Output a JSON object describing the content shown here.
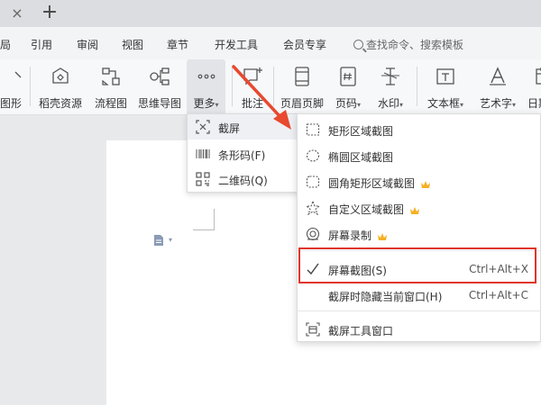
{
  "titlebar": {
    "close_glyph": "×",
    "add_glyph": "+"
  },
  "menu": {
    "items": [
      "局",
      "引用",
      "审阅",
      "视图",
      "章节",
      "开发工具",
      "会员专享"
    ],
    "search_placeholder": "查找命令、搜索模板"
  },
  "ribbon": {
    "items": [
      {
        "label": "图形",
        "icon": "shapes-icon"
      },
      {
        "label": "稻壳资源",
        "icon": "docer-icon"
      },
      {
        "label": "流程图",
        "icon": "flowchart-icon"
      },
      {
        "label": "思维导图",
        "icon": "mindmap-icon"
      },
      {
        "label": "更多",
        "icon": "more-icon"
      },
      {
        "label": "批注",
        "icon": "comment-icon"
      },
      {
        "label": "页眉页脚",
        "icon": "header-footer-icon"
      },
      {
        "label": "页码",
        "icon": "page-number-icon"
      },
      {
        "label": "水印",
        "icon": "watermark-icon"
      },
      {
        "label": "文本框",
        "icon": "textbox-icon"
      },
      {
        "label": "艺术字",
        "icon": "wordart-icon"
      },
      {
        "label": "日期",
        "icon": "date-icon"
      }
    ],
    "caret": "▾"
  },
  "dropdown1": {
    "items": [
      {
        "label": "截屏",
        "icon": "screenshot-icon"
      },
      {
        "label": "条形码(F)",
        "icon": "barcode-icon"
      },
      {
        "label": "二维码(Q)",
        "icon": "qrcode-icon"
      }
    ]
  },
  "dropdown2": {
    "items": [
      {
        "label": "矩形区域截图",
        "icon": "rect-region-icon",
        "shortcut": "",
        "premium": false
      },
      {
        "label": "椭圆区域截图",
        "icon": "ellipse-region-icon",
        "shortcut": "",
        "premium": false
      },
      {
        "label": "圆角矩形区域截图",
        "icon": "rounded-rect-region-icon",
        "shortcut": "",
        "premium": true
      },
      {
        "label": "自定义区域截图",
        "icon": "custom-region-icon",
        "shortcut": "",
        "premium": true
      },
      {
        "label": "屏幕录制",
        "icon": "screen-record-icon",
        "shortcut": "",
        "premium": true
      },
      {
        "label": "屏幕截图(S)",
        "icon": "check-icon",
        "shortcut": "Ctrl+Alt+X",
        "premium": false
      },
      {
        "label": "截屏时隐藏当前窗口(H)",
        "icon": "",
        "shortcut": "Ctrl+Alt+C",
        "premium": false
      },
      {
        "label": "截屏工具窗口",
        "icon": "screenshot-tool-icon",
        "shortcut": "",
        "premium": false
      }
    ]
  },
  "colors": {
    "highlight": "#e0352b",
    "arrow": "#e8492f",
    "crown": "#f5b022",
    "doc_icon": "#8a9bb5"
  }
}
